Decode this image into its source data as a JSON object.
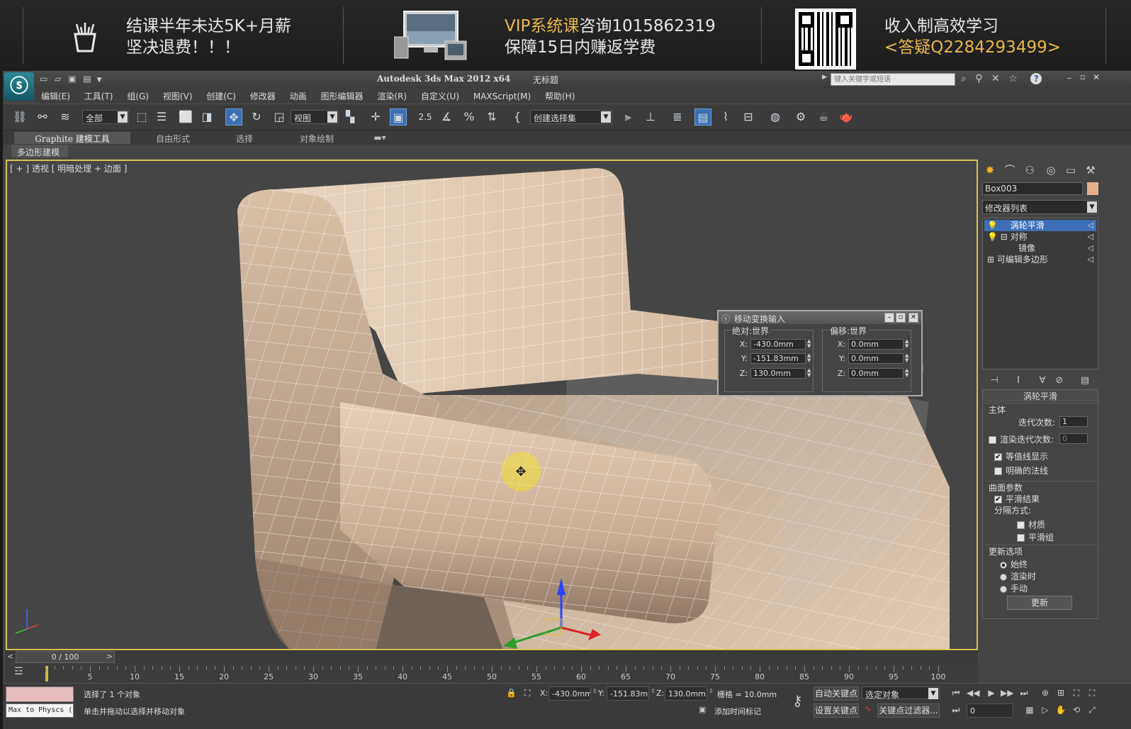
{
  "banner": {
    "left_line1": "结课半年未达5K+月薪",
    "left_line2": "坚决退费！！！",
    "mid_line1_accent": "VIP系统课",
    "mid_line1_rest": "咨询1015862319",
    "mid_line2": "保障15日内赚返学费",
    "right_line1": "收入制高效学习",
    "right_line2_prefix": "<答疑",
    "right_line2_accent": "Q2284293499",
    "right_line2_suffix": ">"
  },
  "titlebar": {
    "app_title": "Autodesk 3ds Max  2012 x64",
    "doc_title": "无标题",
    "search_placeholder": "键入关键字或短语"
  },
  "menu": [
    "编辑(E)",
    "工具(T)",
    "组(G)",
    "视图(V)",
    "创建(C)",
    "修改器",
    "动画",
    "图形编辑器",
    "渲染(R)",
    "自定义(U)",
    "MAXScript(M)",
    "帮助(H)"
  ],
  "toolbar": {
    "filter": "全部",
    "refcoord": "视图",
    "snap_angle": "2.5",
    "selection_set": "创建选择集"
  },
  "ribbon": {
    "tabs": [
      "Graphite 建模工具",
      "自由形式",
      "选择",
      "对象绘制"
    ],
    "sub": "多边形建模"
  },
  "viewport": {
    "label": "[ + ] 透视 [ 明暗处理 + 边面 ]"
  },
  "move_dialog": {
    "title": "移动变换输入",
    "abs_group": "绝对:世界",
    "offset_group": "偏移:世界",
    "abs": [
      {
        "axis": "X:",
        "value": "-430.0mm"
      },
      {
        "axis": "Y:",
        "value": "-151.83mm"
      },
      {
        "axis": "Z:",
        "value": "130.0mm"
      }
    ],
    "offset": [
      {
        "axis": "X:",
        "value": "0.0mm"
      },
      {
        "axis": "Y:",
        "value": "0.0mm"
      },
      {
        "axis": "Z:",
        "value": "0.0mm"
      }
    ]
  },
  "command_panel": {
    "object_name": "Box003",
    "object_color": "#e4b08c",
    "modifier_list": "修改器列表",
    "stack": [
      "涡轮平滑",
      "对称",
      "镜像",
      "可编辑多边形"
    ],
    "rollout_title": "涡轮平滑",
    "main_label": "主体",
    "iterations_label": "迭代次数:",
    "iterations_value": "1",
    "render_iters_label": "渲染迭代次数:",
    "render_iters_value": "0",
    "isoline": "等值线显示",
    "explicit_normals": "明确的法线",
    "surface_label": "曲面参数",
    "smooth_result": "平滑结果",
    "separate_by": "分隔方式:",
    "materials": "材质",
    "smoothing_groups": "平滑组",
    "update_options": "更新选项",
    "always": "始终",
    "when_rendering": "渲染时",
    "manually": "手动",
    "update_button": "更新"
  },
  "timeline": {
    "slider_label": "0 / 100",
    "ticks": [
      5,
      10,
      15,
      20,
      25,
      30,
      35,
      40,
      45,
      50,
      55,
      60,
      65,
      70,
      75,
      80,
      85,
      90,
      95,
      100
    ]
  },
  "status": {
    "maxscript": "Max to Physcs (",
    "selected": "选择了 1 个对象",
    "prompt": "单击并拖动以选择并移动对象",
    "x_label": "X:",
    "x": "-430.0mm",
    "y_label": "Y:",
    "y": "-151.83mm",
    "z_label": "Z:",
    "z": "130.0mm",
    "grid": "栅格 = 10.0mm",
    "add_time_tag": "添加时间标记",
    "auto_key": "自动关键点",
    "set_key": "设置关键点",
    "selected_obj": "选定对象",
    "key_filters": "关键点过滤器...",
    "frame": "0"
  }
}
